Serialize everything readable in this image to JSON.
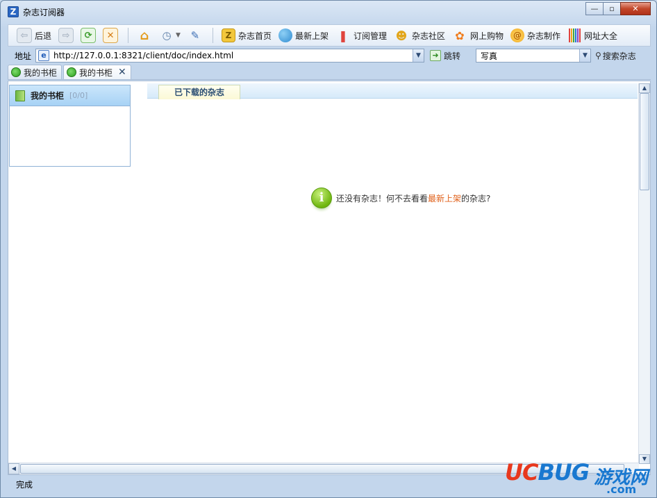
{
  "window": {
    "title": "杂志订阅器",
    "app_icon": "Z"
  },
  "toolbar": {
    "back_label": "后退",
    "items": [
      {
        "label": "杂志首页"
      },
      {
        "label": "最新上架"
      },
      {
        "label": "订阅管理"
      },
      {
        "label": "杂志社区"
      },
      {
        "label": "网上购物"
      },
      {
        "label": "杂志制作"
      },
      {
        "label": "网址大全"
      }
    ]
  },
  "address": {
    "label": "地址",
    "url": "http://127.0.0.1:8321/client/doc/index.html",
    "go_label": "跳转",
    "search_value": "写真",
    "search_label": "搜索杂志"
  },
  "tabs": [
    {
      "label": "我的书柜"
    },
    {
      "label": "我的书柜"
    }
  ],
  "shelf": {
    "title": "我的书柜",
    "count": "[0/0]"
  },
  "main": {
    "subtab_label": "已下载的杂志",
    "empty_before": "还没有杂志！何不去看看",
    "empty_link": "最新上架",
    "empty_after": "的杂志?"
  },
  "status": {
    "text": "完成"
  },
  "watermark": {
    "logo_a": "UC",
    "logo_b": "BUG",
    "cn": "游戏网",
    "domain": ".com"
  },
  "colors": {
    "link": "#e0621c",
    "accent": "#2b67c3"
  }
}
